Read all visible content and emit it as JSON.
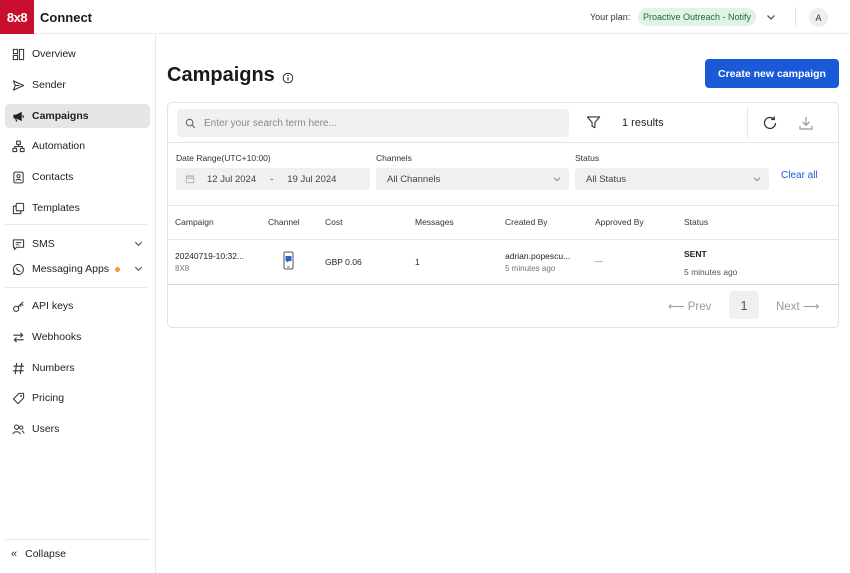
{
  "header": {
    "logo_text": "8x8",
    "app_name": "Connect",
    "plan_label": "Your plan:",
    "plan_name": "Proactive Outreach - Notify",
    "avatar_initial": "A"
  },
  "sidebar": {
    "items": [
      {
        "label": "Overview",
        "icon": "overview-icon"
      },
      {
        "label": "Sender",
        "icon": "send-icon"
      },
      {
        "label": "Campaigns",
        "icon": "megaphone-icon",
        "active": true
      },
      {
        "label": "Automation",
        "icon": "automation-icon"
      },
      {
        "label": "Contacts",
        "icon": "contacts-icon"
      },
      {
        "label": "Templates",
        "icon": "templates-icon"
      },
      {
        "label": "SMS",
        "icon": "chat-icon"
      },
      {
        "label": "Messaging Apps",
        "icon": "whatsapp-icon"
      },
      {
        "label": "API keys",
        "icon": "key-icon"
      },
      {
        "label": "Webhooks",
        "icon": "webhooks-icon"
      },
      {
        "label": "Numbers",
        "icon": "hash-icon"
      },
      {
        "label": "Pricing",
        "icon": "tag-icon"
      },
      {
        "label": "Users",
        "icon": "users-icon"
      }
    ],
    "collapse_label": "Collapse"
  },
  "main": {
    "title": "Campaigns",
    "create_button": "Create new campaign",
    "search_placeholder": "Enter your search term here...",
    "results_text": "1 results",
    "filters": {
      "date_label": "Date Range(UTC+10:00)",
      "date_from": "12 Jul 2024",
      "date_sep": "-",
      "date_to": "19 Jul 2024",
      "channels_label": "Channels",
      "channels_value": "All Channels",
      "status_label": "Status",
      "status_value": "All Status",
      "clear_all": "Clear all"
    },
    "table": {
      "headers": [
        "Campaign",
        "Channel",
        "Cost",
        "Messages",
        "Created By",
        "Approved By",
        "Status"
      ],
      "rows": [
        {
          "campaign": "20240719-10:32...",
          "campaign_sub": "8X8",
          "channel_icon": "mobile-sms-icon",
          "cost": "GBP 0.06",
          "messages": "1",
          "created_by": "adrian.popescu...",
          "created_ago": "5 minutes ago",
          "approved_by": "—",
          "status": "SENT",
          "status_ago": "5 minutes ago"
        }
      ]
    },
    "pagination": {
      "prev": "Prev",
      "page": "1",
      "next": "Next"
    }
  }
}
